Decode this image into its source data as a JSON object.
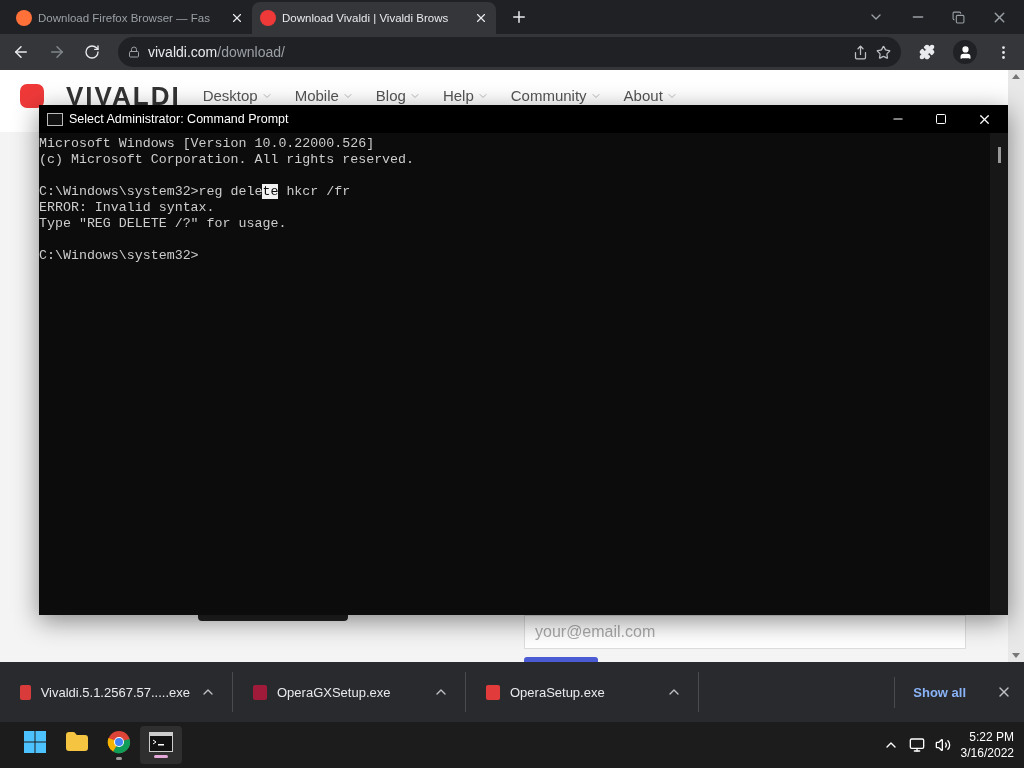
{
  "browser": {
    "tabs": [
      {
        "title": "Download Firefox Browser — Fas",
        "selected": false,
        "kind": "firefox"
      },
      {
        "title": "Download Vivaldi | Vivaldi Brows",
        "selected": true,
        "kind": "vivaldi"
      }
    ],
    "address": {
      "domain": "vivaldi.com",
      "path": "/download/"
    }
  },
  "page": {
    "logo": "VIVALDI",
    "nav": [
      "Desktop",
      "Mobile",
      "Blog",
      "Help",
      "Community",
      "About"
    ],
    "email_placeholder": "your@email.com"
  },
  "console": {
    "title": "Select Administrator: Command Prompt",
    "blocks": [
      [
        {
          "parts": [
            {
              "text": "Microsoft Windows [Version 10.0.22000.526]",
              "selected": false
            }
          ]
        },
        {
          "parts": [
            {
              "text": "(c) Microsoft Corporation. All rights reserved.",
              "selected": false
            }
          ]
        }
      ],
      [
        {
          "parts": [
            {
              "text": "C:\\Windows\\system32>reg dele",
              "selected": false
            },
            {
              "text": "te",
              "selected": true
            },
            {
              "text": " hkcr /fr",
              "selected": false
            }
          ]
        },
        {
          "parts": [
            {
              "text": "ERROR: Invalid syntax.",
              "selected": false
            }
          ]
        },
        {
          "parts": [
            {
              "text": "Type \"REG DELETE /?\" for usage.",
              "selected": false
            }
          ]
        }
      ],
      [
        {
          "parts": [
            {
              "text": "C:\\Windows\\system32>",
              "selected": false
            }
          ]
        }
      ]
    ]
  },
  "downloads": {
    "items": [
      {
        "name": "Vivaldi.5.1.2567.57.....exe",
        "kind": "vivaldi"
      },
      {
        "name": "OperaGXSetup.exe",
        "kind": "operagx"
      },
      {
        "name": "OperaSetup.exe",
        "kind": "opera"
      }
    ],
    "show_all": "Show all"
  },
  "taskbar": {
    "apps": [
      {
        "kind": "start",
        "running": false,
        "selected": false
      },
      {
        "kind": "explorer",
        "running": false,
        "selected": false
      },
      {
        "kind": "chrome",
        "running": true,
        "selected": false
      },
      {
        "kind": "terminal",
        "running": true,
        "selected": true
      }
    ],
    "time": "5:22 PM",
    "date": "3/16/2022"
  }
}
